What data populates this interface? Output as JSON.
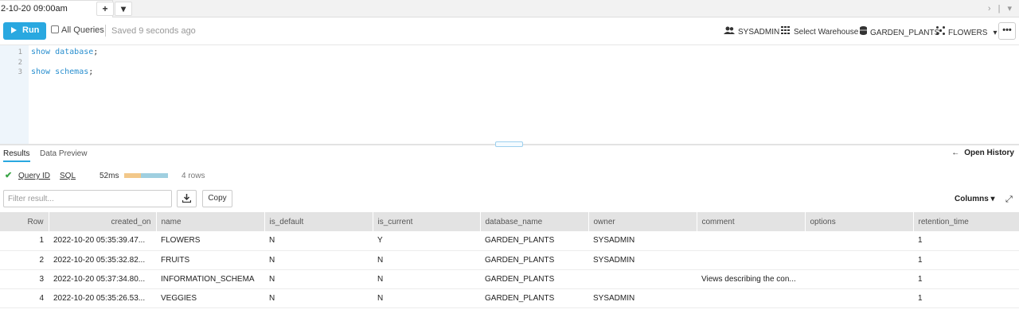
{
  "tab": {
    "title": "2-10-20 09:00am",
    "add_label": "+",
    "menu_label": "▾",
    "right_nav": "› | ▾"
  },
  "toolbar": {
    "run_label": "Run",
    "all_queries_label": "All Queries",
    "saved_text": "Saved 9 seconds ago",
    "role": "SYSADMIN",
    "warehouse": "Select Warehouse",
    "database": "GARDEN_PLANTS",
    "schema": "FLOWERS",
    "more_label": "•••"
  },
  "editor": {
    "lines": [
      {
        "num": "1",
        "kw": "show database",
        "end": ";"
      },
      {
        "num": "2",
        "kw": "",
        "end": ""
      },
      {
        "num": "3",
        "kw": "show schemas",
        "end": ";"
      }
    ]
  },
  "results": {
    "tab_results": "Results",
    "tab_preview": "Data Preview",
    "open_history": "Open History",
    "query_id_label": "Query ID",
    "sql_label": "SQL",
    "duration": "52ms",
    "rows_count": "4 rows",
    "filter_placeholder": "Filter result...",
    "copy_label": "Copy",
    "columns_label": "Columns ▾",
    "bar_colors": [
      "#f2c88a",
      "#9fcfe0"
    ]
  },
  "table": {
    "headers": [
      "Row",
      "created_on",
      "name",
      "is_default",
      "is_current",
      "database_name",
      "owner",
      "comment",
      "options",
      "retention_time"
    ],
    "rows": [
      [
        "1",
        "2022-10-20 05:35:39.47...",
        "FLOWERS",
        "N",
        "Y",
        "GARDEN_PLANTS",
        "SYSADMIN",
        "",
        "",
        "1"
      ],
      [
        "2",
        "2022-10-20 05:35:32.82...",
        "FRUITS",
        "N",
        "N",
        "GARDEN_PLANTS",
        "SYSADMIN",
        "",
        "",
        "1"
      ],
      [
        "3",
        "2022-10-20 05:37:34.80...",
        "INFORMATION_SCHEMA",
        "N",
        "N",
        "GARDEN_PLANTS",
        "",
        "Views describing the con...",
        "",
        "1"
      ],
      [
        "4",
        "2022-10-20 05:35:26.53...",
        "VEGGIES",
        "N",
        "N",
        "GARDEN_PLANTS",
        "SYSADMIN",
        "",
        "",
        "1"
      ]
    ]
  }
}
